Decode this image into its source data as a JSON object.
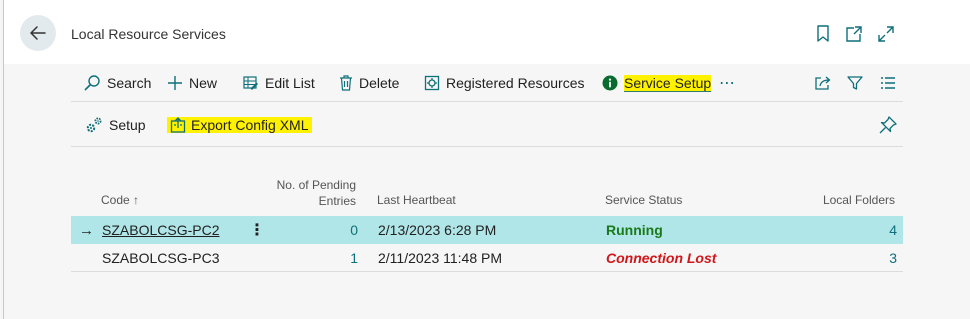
{
  "header": {
    "title": "Local Resource Services"
  },
  "actions": {
    "search": "Search",
    "new": "New",
    "edit_list": "Edit List",
    "delete": "Delete",
    "registered_resources": "Registered Resources",
    "service_setup": "Service Setup",
    "more": "⋯"
  },
  "subactions": {
    "setup": "Setup",
    "export_config_xml": "Export Config XML"
  },
  "columns": {
    "code": "Code ↑",
    "pending_line1": "No. of Pending",
    "pending_line2": "Entries",
    "last_heartbeat": "Last Heartbeat",
    "service_status": "Service Status",
    "local_folders": "Local Folders"
  },
  "rows": [
    {
      "arrow": "→",
      "code": "SZABOLCSG-PC2",
      "menu": "⋮",
      "pending": "0",
      "heartbeat": "2/13/2023 6:28 PM",
      "status": "Running",
      "folders": "4"
    },
    {
      "code": "SZABOLCSG-PC3",
      "pending": "1",
      "heartbeat": "2/11/2023 11:48 PM",
      "status": "Connection Lost",
      "folders": "3"
    }
  ],
  "colors": {
    "accent": "#0f6f7a",
    "selected_row": "#b1e6e8",
    "highlight": "#fff200",
    "running": "#1a7a1a",
    "connection_lost": "#d0161b"
  }
}
